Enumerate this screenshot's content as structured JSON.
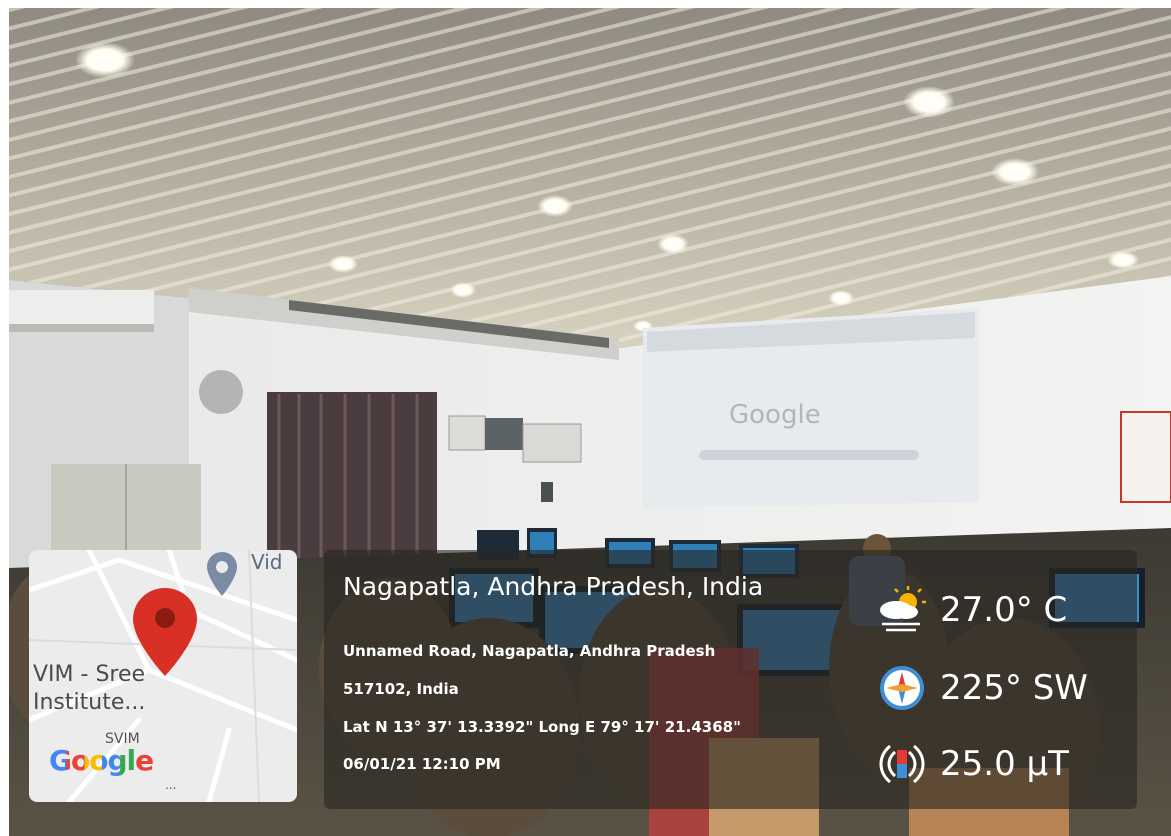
{
  "overlay": {
    "location_title": "Nagapatla, Andhra Pradesh, India",
    "address_line_1": "Unnamed Road, Nagapatla, Andhra Pradesh",
    "address_line_2": "517102, India",
    "coordinates": "Lat N 13° 37' 13.3392\" Long E 79° 17' 21.4368\"",
    "datetime": "06/01/21 12:10 PM",
    "temperature": "27.0° C",
    "wind_direction": "225° SW",
    "magnetic_field": "25.0 µT",
    "icons": [
      "weather-partly-cloudy-icon",
      "compass-icon",
      "magnetometer-icon"
    ]
  },
  "map": {
    "poi_label": "Vid",
    "place_label_line1": "VIM - Sree",
    "place_label_line2": "Institute...",
    "place_label_3": "SVIM",
    "logo_text": "Google",
    "ellipsis": "...",
    "pin_color": "#d93025"
  },
  "scene": {
    "projector_screen_text": "Google"
  }
}
